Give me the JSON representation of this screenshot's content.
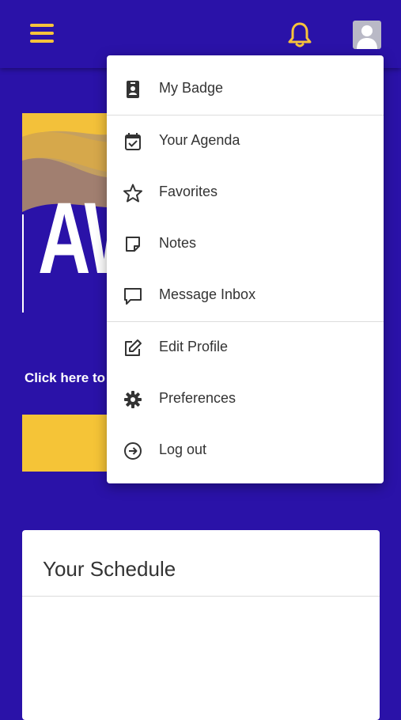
{
  "header": {
    "menu_icon": "hamburger-menu-icon",
    "notification_icon": "bell-icon",
    "profile_icon": "user-avatar-icon",
    "accent_color": "#f7c33b",
    "background_color": "#2a12a8"
  },
  "banner": {
    "partial_text": "AW"
  },
  "cta": {
    "text": "Click here to"
  },
  "schedule": {
    "title": "Your Schedule"
  },
  "menu": {
    "items": [
      {
        "label": "My Badge",
        "icon": "badge-icon"
      },
      {
        "label": "Your Agenda",
        "icon": "calendar-check-icon"
      },
      {
        "label": "Favorites",
        "icon": "star-icon"
      },
      {
        "label": "Notes",
        "icon": "note-icon"
      },
      {
        "label": "Message Inbox",
        "icon": "message-icon"
      },
      {
        "label": "Edit Profile",
        "icon": "edit-icon"
      },
      {
        "label": "Preferences",
        "icon": "gear-icon"
      },
      {
        "label": "Log out",
        "icon": "logout-icon"
      }
    ]
  }
}
